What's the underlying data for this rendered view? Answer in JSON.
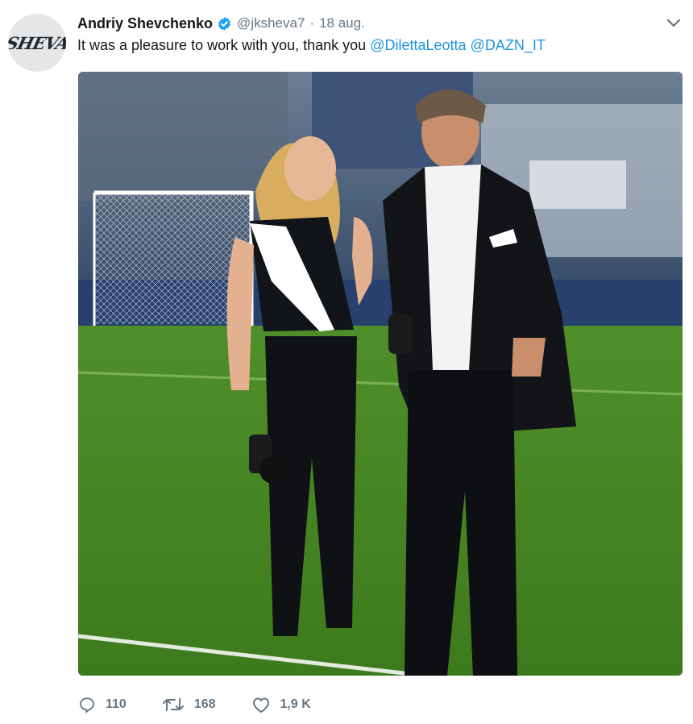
{
  "tweet": {
    "avatar_text": "SHEVA",
    "author_name": "Andriy Shevchenko",
    "verified": true,
    "handle": "@jksheva7",
    "separator": "·",
    "date": "18 aug.",
    "text_prefix": "It was a pleasure to work with you, thank you ",
    "mention_1": "@DilettaLeotta",
    "mention_2": "@DAZN_IT",
    "media_icon": "stadium-photo",
    "colors": {
      "accent": "#1b95e0",
      "muted": "#657786",
      "text": "#14171a"
    }
  },
  "actions": {
    "reply_count": "110",
    "retweet_count": "168",
    "like_count": "1,9 K"
  },
  "icons": {
    "verified": "verified-badge-icon",
    "menu": "chevron-down-icon",
    "reply": "reply-icon",
    "retweet": "retweet-icon",
    "like": "heart-icon"
  }
}
